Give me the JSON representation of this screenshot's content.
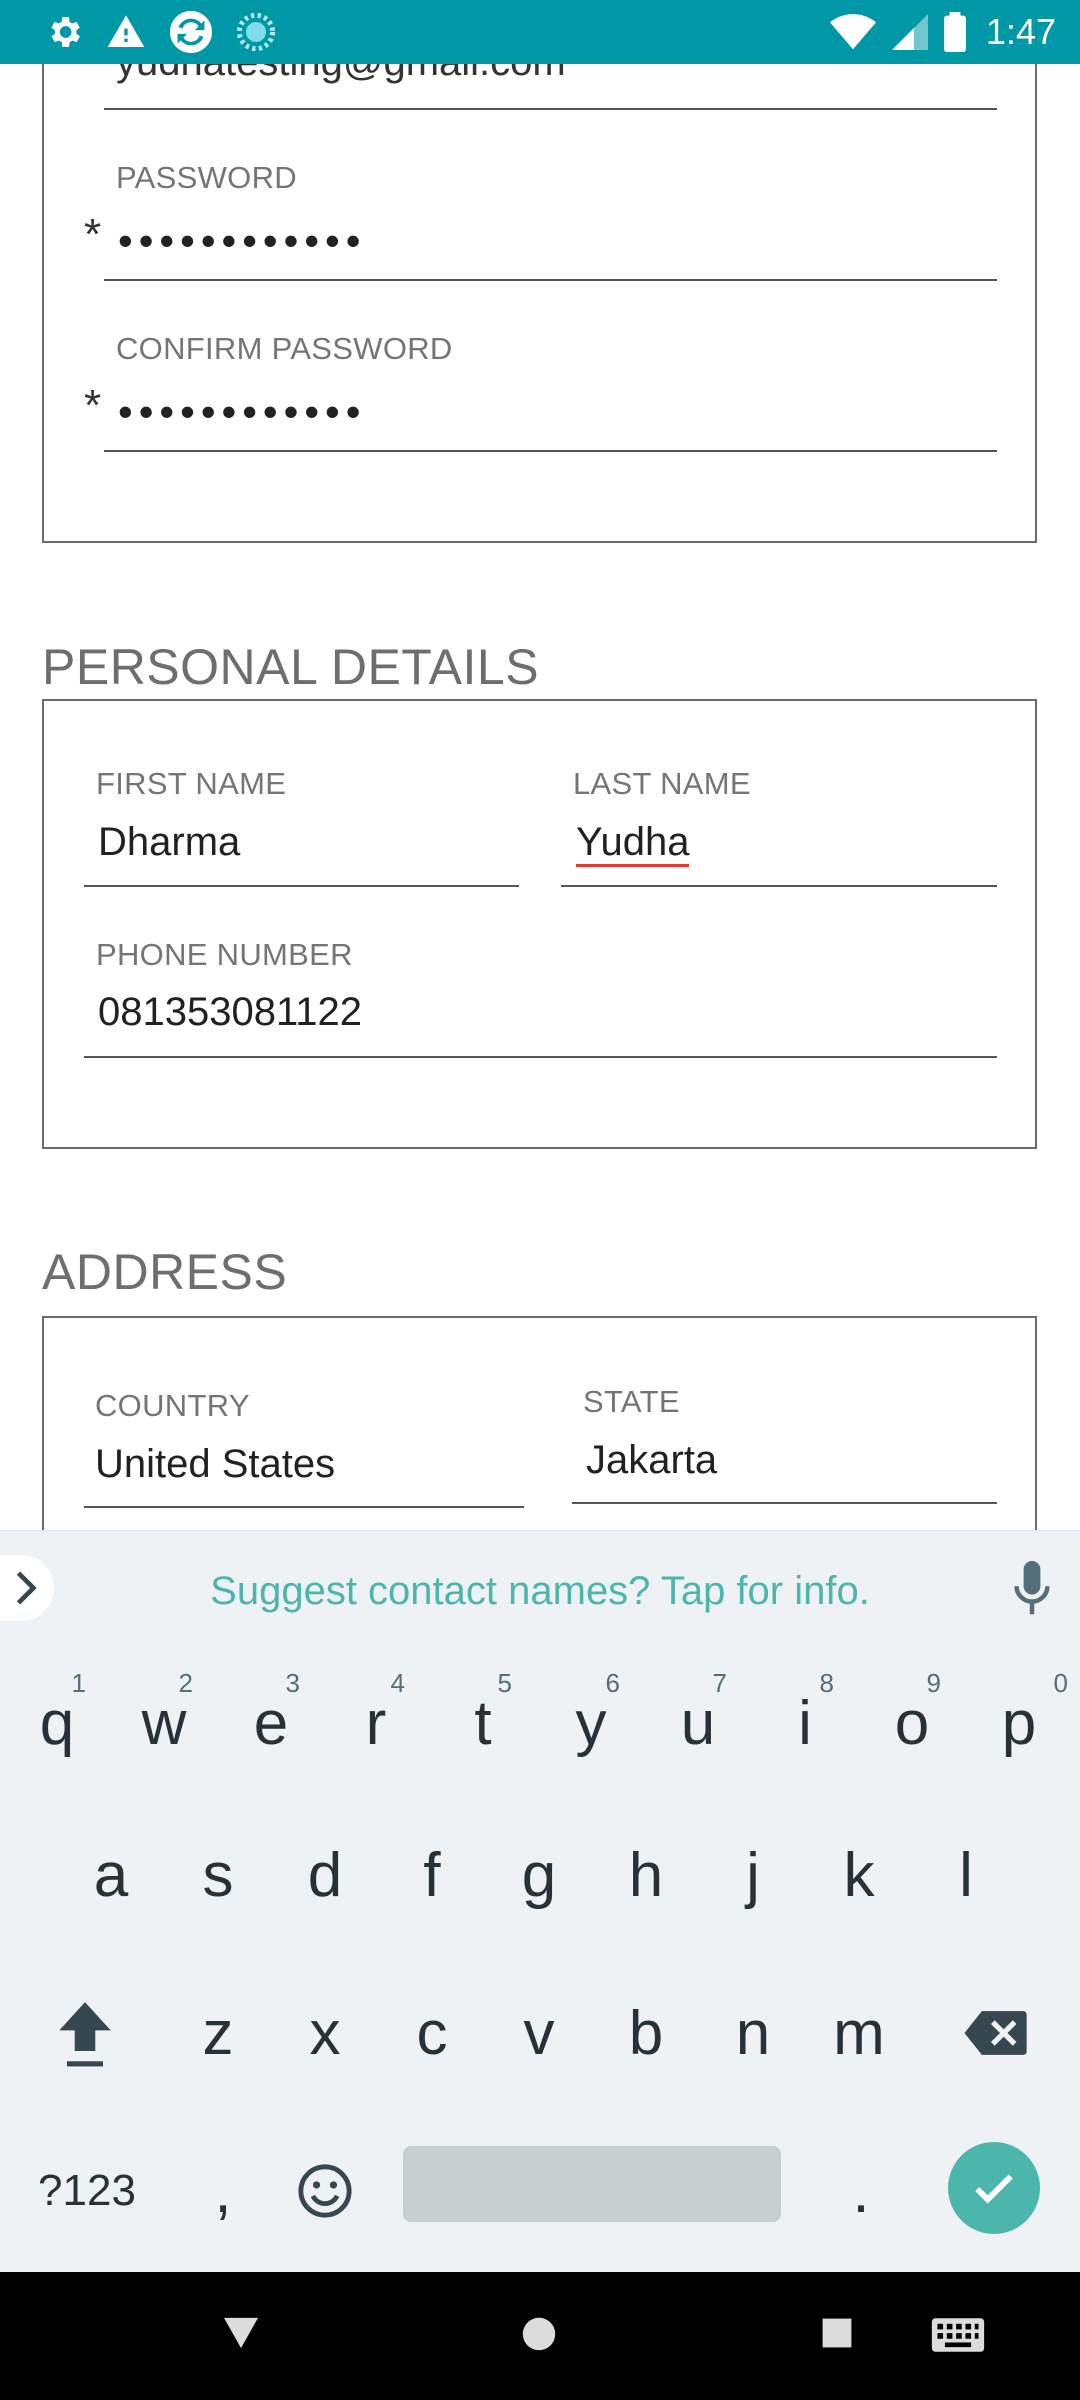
{
  "status_bar": {
    "time": "1:47",
    "left_icons": [
      "settings-icon",
      "warning-icon",
      "sync-app-icon",
      "loading-icon"
    ],
    "right_icons": [
      "wifi-icon",
      "signal-icon",
      "battery-icon"
    ]
  },
  "account_section": {
    "email_value_partial": "yudhatesting@gmail.com",
    "password": {
      "label": "PASSWORD",
      "value_masked": "••••••••••••",
      "required_mark": "*"
    },
    "confirm_password": {
      "label": "CONFIRM PASSWORD",
      "value_masked": "••••••••••••",
      "required_mark": "*"
    }
  },
  "personal_details": {
    "title": "PERSONAL DETAILS",
    "first_name": {
      "label": "FIRST NAME",
      "value": "Dharma"
    },
    "last_name": {
      "label": "LAST NAME",
      "value": "Yudha"
    },
    "phone_number": {
      "label": "PHONE NUMBER",
      "value": "081353081122"
    }
  },
  "address": {
    "title": "ADDRESS",
    "country": {
      "label": "COUNTRY",
      "value": "United States"
    },
    "state": {
      "label": "STATE",
      "value": "Jakarta"
    }
  },
  "suggestion_bar": {
    "text": "Suggest contact names? Tap for info."
  },
  "keyboard": {
    "row1": [
      {
        "key": "q",
        "hint": "1"
      },
      {
        "key": "w",
        "hint": "2"
      },
      {
        "key": "e",
        "hint": "3"
      },
      {
        "key": "r",
        "hint": "4"
      },
      {
        "key": "t",
        "hint": "5"
      },
      {
        "key": "y",
        "hint": "6"
      },
      {
        "key": "u",
        "hint": "7"
      },
      {
        "key": "i",
        "hint": "8"
      },
      {
        "key": "o",
        "hint": "9"
      },
      {
        "key": "p",
        "hint": "0"
      }
    ],
    "row2": [
      "a",
      "s",
      "d",
      "f",
      "g",
      "h",
      "j",
      "k",
      "l"
    ],
    "row3": [
      "z",
      "x",
      "c",
      "v",
      "b",
      "n",
      "m"
    ],
    "symbols_label": "?123",
    "comma": ",",
    "period": ".",
    "colors": {
      "accent": "#4db6ac",
      "background": "#eef2f4",
      "status_bar": "#0097a7"
    }
  }
}
